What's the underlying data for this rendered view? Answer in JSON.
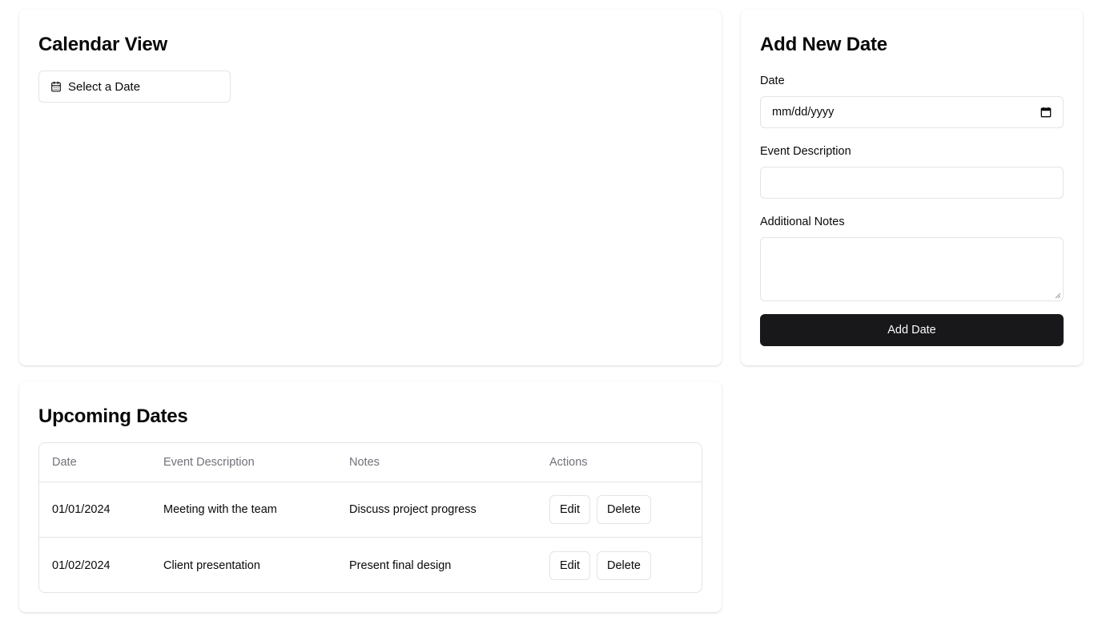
{
  "calendar": {
    "title": "Calendar View",
    "picker_label": "Select a Date"
  },
  "add_form": {
    "title": "Add New Date",
    "date_label": "Date",
    "date_placeholder": "mm/dd/yyyy",
    "description_label": "Event Description",
    "description_value": "",
    "notes_label": "Additional Notes",
    "notes_value": "",
    "submit_label": "Add Date"
  },
  "upcoming": {
    "title": "Upcoming Dates",
    "columns": [
      "Date",
      "Event Description",
      "Notes",
      "Actions"
    ],
    "rows": [
      {
        "date": "01/01/2024",
        "description": "Meeting with the team",
        "notes": "Discuss project progress",
        "edit_label": "Edit",
        "delete_label": "Delete"
      },
      {
        "date": "01/02/2024",
        "description": "Client presentation",
        "notes": "Present final design",
        "edit_label": "Edit",
        "delete_label": "Delete"
      }
    ]
  },
  "colors": {
    "primary": "#18181b",
    "border": "#e4e4e7",
    "muted_text": "#71717a"
  },
  "icons": {
    "date_picker": "calendar-icon",
    "date_input": "calendar-small-icon"
  }
}
